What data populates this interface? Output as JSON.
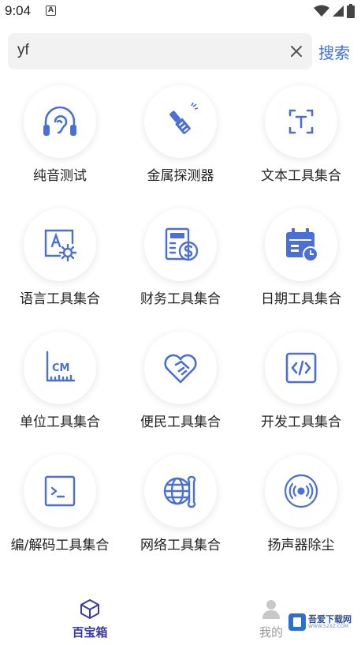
{
  "status_bar": {
    "time": "9:04",
    "notification_letter": "A"
  },
  "search": {
    "value": "yf",
    "button_label": "搜索"
  },
  "tools": [
    {
      "label": "纯音测试",
      "icon": "headphones-ear-icon"
    },
    {
      "label": "金属探测器",
      "icon": "metal-detector-icon"
    },
    {
      "label": "文本工具集合",
      "icon": "text-scan-icon"
    },
    {
      "label": "语言工具集合",
      "icon": "language-settings-icon"
    },
    {
      "label": "财务工具集合",
      "icon": "finance-calculator-icon"
    },
    {
      "label": "日期工具集合",
      "icon": "calendar-clock-icon"
    },
    {
      "label": "单位工具集合",
      "icon": "unit-ruler-icon"
    },
    {
      "label": "便民工具集合",
      "icon": "heart-handshake-icon"
    },
    {
      "label": "开发工具集合",
      "icon": "code-icon"
    },
    {
      "label": "编/解码工具集合",
      "icon": "terminal-icon"
    },
    {
      "label": "网络工具集合",
      "icon": "globe-wrench-icon"
    },
    {
      "label": "扬声器除尘",
      "icon": "speaker-wave-icon"
    }
  ],
  "bottom_nav": [
    {
      "label": "百宝箱",
      "icon": "box-icon",
      "active": true
    },
    {
      "label": "我的",
      "icon": "user-icon",
      "active": false
    }
  ],
  "watermark": {
    "title": "吾爱下载网",
    "subtitle": "WWW.52XZ.COM"
  },
  "colors": {
    "accent": "#3f6fd8",
    "icon_blue": "#4a6fd6",
    "nav_active": "#3a3aa8"
  }
}
